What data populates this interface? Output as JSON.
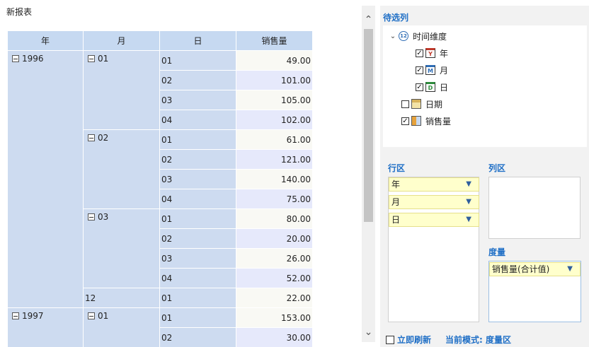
{
  "report": {
    "title": "新报表",
    "headers": [
      "年",
      "月",
      "日",
      "销售量"
    ],
    "year_1996": "1996",
    "year_1997": "1997",
    "months": [
      "01",
      "02",
      "03",
      "12",
      "01"
    ],
    "rows": [
      {
        "day": "01",
        "value": "49.00"
      },
      {
        "day": "02",
        "value": "101.00"
      },
      {
        "day": "03",
        "value": "105.00"
      },
      {
        "day": "04",
        "value": "102.00"
      },
      {
        "day": "01",
        "value": "61.00"
      },
      {
        "day": "02",
        "value": "121.00"
      },
      {
        "day": "03",
        "value": "140.00"
      },
      {
        "day": "04",
        "value": "75.00"
      },
      {
        "day": "01",
        "value": "80.00"
      },
      {
        "day": "02",
        "value": "20.00"
      },
      {
        "day": "03",
        "value": "26.00"
      },
      {
        "day": "04",
        "value": "52.00"
      },
      {
        "day": "01",
        "value": "22.00"
      },
      {
        "day": "01",
        "value": "153.00"
      },
      {
        "day": "02",
        "value": "30.00"
      }
    ]
  },
  "panel": {
    "candidate_title": "待选列",
    "tree": {
      "time_dim": "时间维度",
      "year": "年",
      "month": "月",
      "day": "日",
      "date": "日期",
      "sales": "销售量"
    },
    "row_zone_title": "行区",
    "col_zone_title": "列区",
    "measure_title": "度量",
    "row_fields": [
      "年",
      "月",
      "日"
    ],
    "measure_fields": [
      "销售量(合计值)"
    ],
    "refresh_label": "立即刷新",
    "mode_label": "当前模式: 度量区"
  },
  "colors": {
    "accent": "#1f6fc6",
    "header_bg": "#c6d9f1",
    "chip_bg": "#ffffcc"
  }
}
